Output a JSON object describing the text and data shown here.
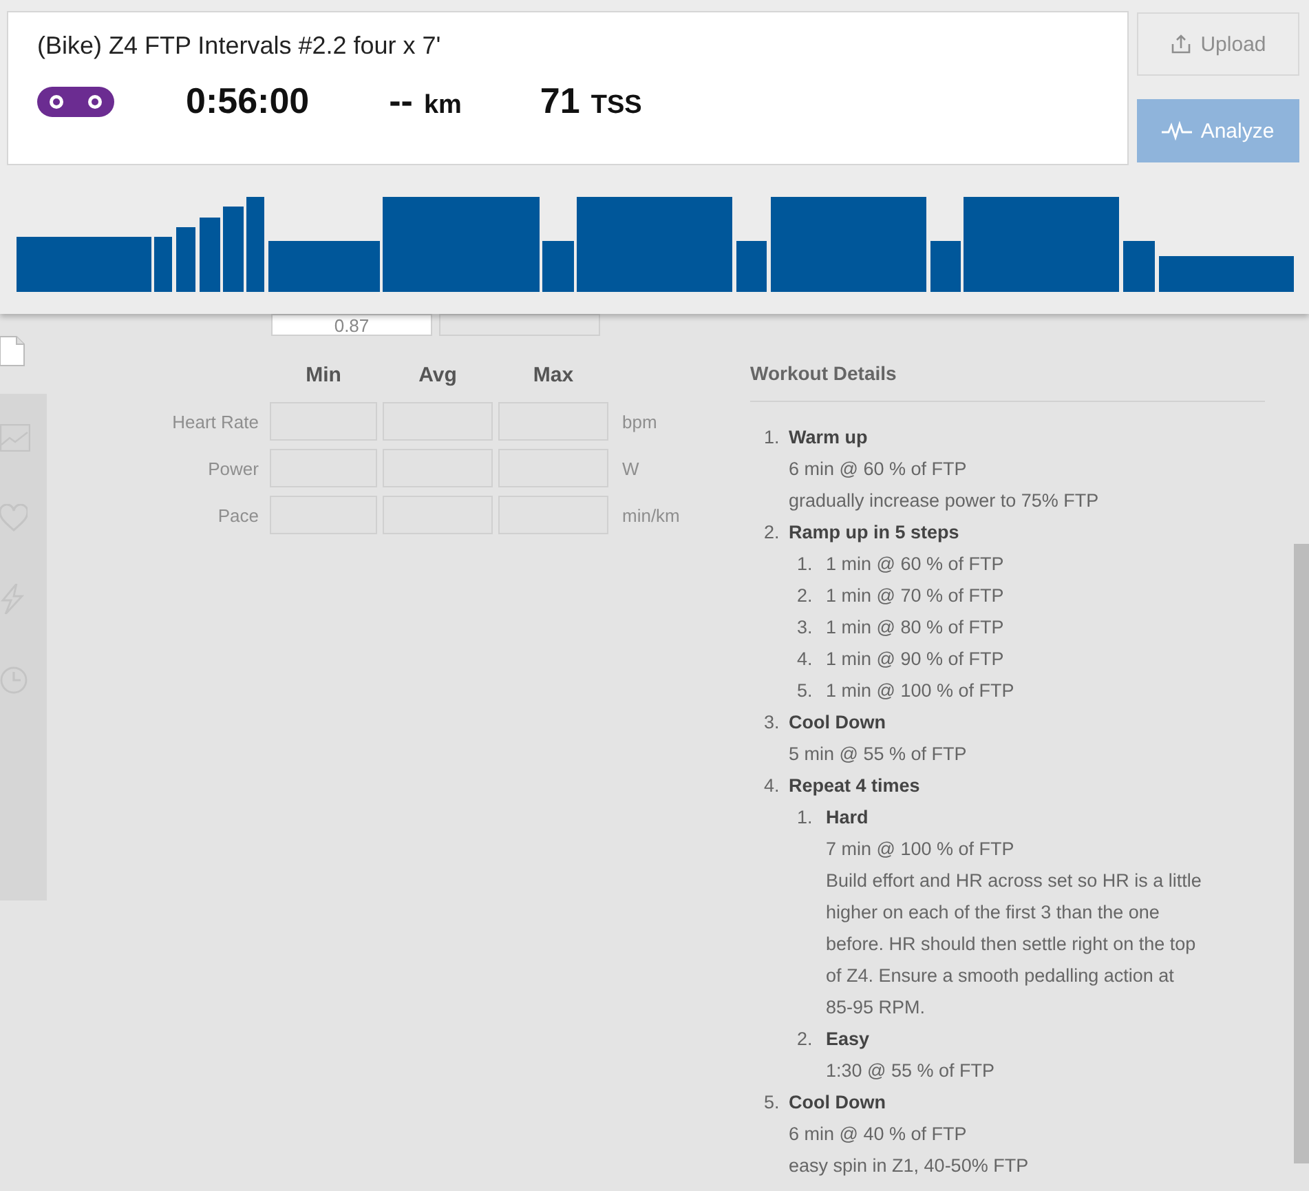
{
  "workout": {
    "title": "(Bike) Z4 FTP Intervals #2.2 four x 7'",
    "duration": "0:56:00",
    "distance_value": "--",
    "distance_unit": "km",
    "tss_value": "71",
    "tss_unit": "TSS"
  },
  "buttons": [
    {
      "kind": "upload",
      "label": "Upload",
      "disabled": true
    },
    {
      "kind": "analyze",
      "label": "Analyze",
      "disabled": false
    }
  ],
  "if_field": {
    "value": "0.87"
  },
  "stats": {
    "columns": [
      "Min",
      "Avg",
      "Max"
    ],
    "rows": [
      {
        "label": "Heart Rate",
        "unit": "bpm"
      },
      {
        "label": "Power",
        "unit": "W"
      },
      {
        "label": "Pace",
        "unit": "min/km"
      }
    ]
  },
  "details": {
    "title": "Workout Details",
    "steps": [
      {
        "number": "1.",
        "title": "Warm up",
        "lines": [
          "6 min @ 60 % of FTP",
          "gradually increase power to 75% FTP"
        ]
      },
      {
        "number": "2.",
        "title": "Ramp up in 5 steps",
        "children": [
          {
            "number": "1.",
            "lines": [
              "1 min @ 60 % of FTP"
            ]
          },
          {
            "number": "2.",
            "lines": [
              "1 min @ 70 % of FTP"
            ]
          },
          {
            "number": "3.",
            "lines": [
              "1 min @ 80 % of FTP"
            ]
          },
          {
            "number": "4.",
            "lines": [
              "1 min @ 90 % of FTP"
            ]
          },
          {
            "number": "5.",
            "lines": [
              "1 min @ 100 % of FTP"
            ]
          }
        ]
      },
      {
        "number": "3.",
        "title": "Cool Down",
        "lines": [
          "5 min @ 55 % of FTP"
        ]
      },
      {
        "number": "4.",
        "title": "Repeat 4 times",
        "children": [
          {
            "number": "1.",
            "title": "Hard",
            "lines": [
              "7 min @ 100 % of FTP",
              "Build effort and HR across set so HR is a little higher on each of the first 3 than the one before. HR should then settle right on the top of Z4. Ensure a smooth pedalling action at 85-95 RPM."
            ]
          },
          {
            "number": "2.",
            "title": "Easy",
            "lines": [
              "1:30 @ 55 % of FTP"
            ]
          }
        ]
      },
      {
        "number": "5.",
        "title": "Cool Down",
        "lines": [
          "6 min @ 40 % of FTP",
          "easy spin in Z1, 40-50% FTP"
        ]
      }
    ]
  }
}
